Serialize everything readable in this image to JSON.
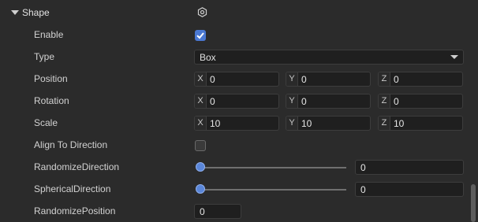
{
  "shape": {
    "title": "Shape",
    "enable_label": "Enable",
    "enable_checked": true,
    "type_label": "Type",
    "type_value": "Box",
    "position_label": "Position",
    "position": {
      "x": "0",
      "y": "0",
      "z": "0"
    },
    "rotation_label": "Rotation",
    "rotation": {
      "x": "0",
      "y": "0",
      "z": "0"
    },
    "scale_label": "Scale",
    "scale": {
      "x": "10",
      "y": "10",
      "z": "10"
    },
    "align_label": "Align To Direction",
    "align_checked": false,
    "randomize_direction_label": "RandomizeDirection",
    "randomize_direction_value": "0",
    "spherical_direction_label": "SphericalDirection",
    "spherical_direction_value": "0",
    "randomize_position_label": "RandomizePosition",
    "randomize_position_value": "0"
  },
  "axes": {
    "x": "X",
    "y": "Y",
    "z": "Z"
  },
  "colors": {
    "accent": "#4a78d2",
    "background": "#2b2b2b",
    "field": "#1f1f1f"
  },
  "icons": {
    "collapse": "caret-down-icon",
    "settings": "hex-gear-icon",
    "dropdown": "chevron-down-icon"
  }
}
